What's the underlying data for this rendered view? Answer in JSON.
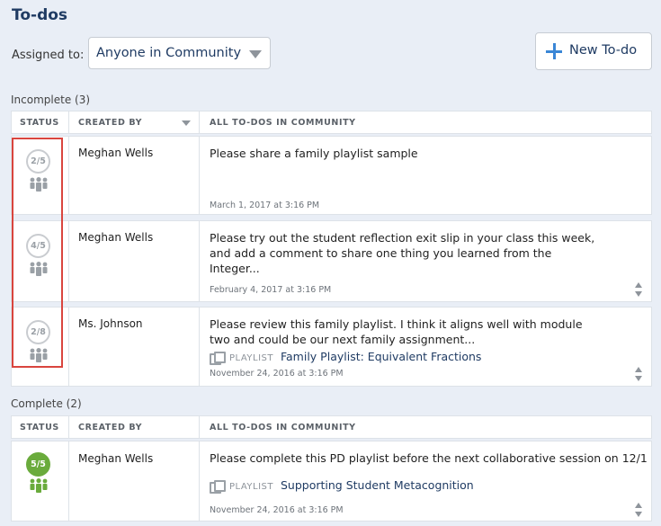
{
  "page": {
    "title": "To-dos",
    "assigned_label": "Assigned to:",
    "assigned_value": "Anyone in Community",
    "new_todo_label": "New To-do"
  },
  "incomplete": {
    "label": "Incomplete (3)",
    "columns": [
      "STATUS",
      "CREATED BY",
      "ALL TO-DOS IN COMMUNITY"
    ],
    "rows": [
      {
        "status": "2/5",
        "creator": "Meghan Wells",
        "text": "Please share a family playlist sample",
        "date": "March 1, 2017 at 3:16 PM"
      },
      {
        "status": "4/5",
        "creator": "Meghan Wells",
        "text": "Please try out the student reflection exit slip in your class this week, and add a comment to share one thing you learned from the Integer...",
        "date": "February 4, 2017 at 3:16 PM"
      },
      {
        "status": "2/8",
        "creator": "Ms. Johnson",
        "text": "Please review this family playlist. I think it aligns well with module two and could be our next family assignment...",
        "playlist_label": "PLAYLIST",
        "playlist_title": "Family Playlist: Equivalent Fractions",
        "date": "November 24, 2016 at 3:16 PM"
      }
    ]
  },
  "complete": {
    "label": "Complete (2)",
    "columns": [
      "STATUS",
      "CREATED BY",
      "ALL TO-DOS IN COMMUNITY"
    ],
    "rows": [
      {
        "status": "5/5",
        "creator": "Meghan Wells",
        "text": "Please complete this PD playlist before the next collaborative session on 12/1",
        "playlist_label": "PLAYLIST",
        "playlist_title": "Supporting Student Metacognition",
        "date": "November 24, 2016 at 3:16 PM"
      }
    ]
  },
  "icons": {
    "status_group": "people-group-icon",
    "new_todo": "plus-icon",
    "playlist": "playlist-icon",
    "expand": "expand-arrows-icon",
    "dropdown": "caret-down-icon"
  },
  "colors": {
    "accent": "#3a86d6",
    "complete": "#6aab3c",
    "highlight": "#d9453e",
    "title": "#1f3b63"
  }
}
